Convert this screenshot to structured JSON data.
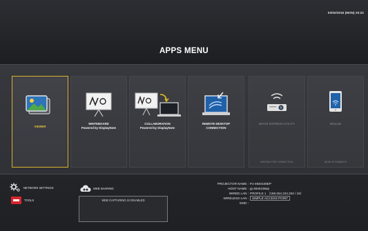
{
  "header": {
    "datetime": "03/02/2016 (MON) 20:22",
    "title": "APPS MENU"
  },
  "tiles": [
    {
      "label1": "VIEWER",
      "label2": "",
      "status": "",
      "icon": "viewer-icon"
    },
    {
      "label1": "WHITEBOARD",
      "label2": "Powered by DisplayNote",
      "status": "",
      "icon": "whiteboard-icon"
    },
    {
      "label1": "COLLABORATION",
      "label2": "Powered by DisplayNote",
      "status": "",
      "icon": "collaboration-icon"
    },
    {
      "label1": "REMOTE DESKTOP",
      "label2": "CONNECTION",
      "status": "",
      "icon": "remote-desktop-icon"
    },
    {
      "label1": "IMAGE EXPRESS UTILITY",
      "label2": "",
      "status": "WAITING FOR CONNECTION",
      "icon": "image-express-icon"
    },
    {
      "label1": "Miracast",
      "label2": "",
      "status": "WLAN IS DISABLED",
      "icon": "miracast-icon"
    }
  ],
  "bottom": {
    "network_settings": "NETWORK SETTINGS",
    "tools": "TOOLS",
    "web_sharing": "WEB SHARING",
    "web_sharing_status": "WEB CAPTURING IS DISABLED"
  },
  "info": [
    {
      "key": "PROJECTOR NAME :",
      "value": "PJ-4940106EP"
    },
    {
      "key": "HOST NAME :",
      "value": "pj-4940106ep"
    },
    {
      "key": "WIRED LAN :",
      "value": "PROFILE 1 （169.254.234.204 / 16）"
    },
    {
      "key": "WIRELESS LAN :",
      "value": "SIMPLE ACCESS POINT"
    },
    {
      "key": "SSID :",
      "value": ""
    }
  ],
  "colors": {
    "accent": "#d8b42a",
    "tools_badge": "#d7262d",
    "background": "#2b2c30"
  }
}
